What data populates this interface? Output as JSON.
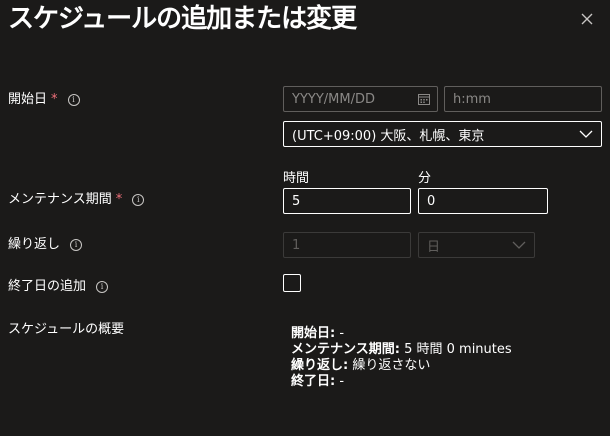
{
  "dialog": {
    "title": "スケジュールの追加または変更",
    "close_glyph": "×"
  },
  "start_date": {
    "label": "開始日",
    "required_mark": "*",
    "info_glyph": "i",
    "date_placeholder": "YYYY/MM/DD",
    "time_placeholder": "h:mm",
    "timezone_value": "(UTC+09:00) 大阪、札幌、東京"
  },
  "duration": {
    "label": "メンテナンス期間",
    "required_mark": "*",
    "info_glyph": "i",
    "hours_header": "時間",
    "minutes_header": "分",
    "hours_value": "5",
    "minutes_value": "0"
  },
  "repeat": {
    "label": "繰り返し",
    "info_glyph": "i",
    "count_value": "1",
    "unit_value": "日"
  },
  "add_end_date": {
    "label": "終了日の追加",
    "info_glyph": "i",
    "checked": false
  },
  "summary": {
    "label": "スケジュールの概要",
    "start_key": "開始日:",
    "start_value": "-",
    "duration_key": "メンテナンス期間:",
    "duration_value": "5 時間 0 minutes",
    "repeat_key": "繰り返し:",
    "repeat_value": "繰り返さない",
    "end_key": "終了日:",
    "end_value": "-"
  },
  "colors": {
    "background": "#1b1a19",
    "text": "#ffffff",
    "required": "#f1707b",
    "border": "#8a8886"
  },
  "icons": {
    "close": "close-icon",
    "info": "info-icon",
    "calendar": "calendar-icon",
    "dropdown": "chevron-down-icon"
  }
}
